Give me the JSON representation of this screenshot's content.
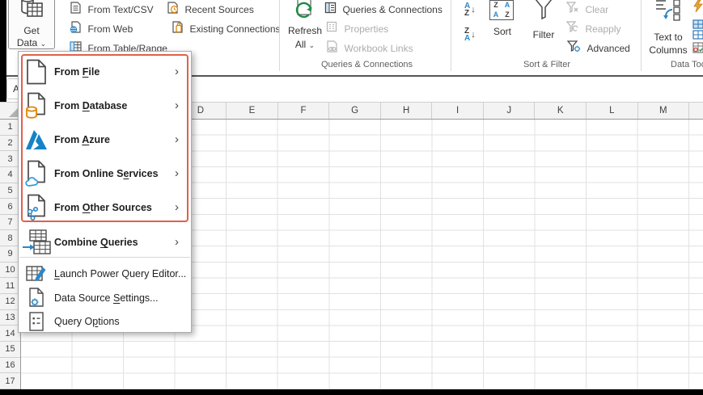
{
  "icons": {
    "submenu_chevron": "›",
    "dropdown_caret": "⌄",
    "sort_arrow": "↓",
    "letter_a": "A",
    "letter_z": "Z"
  },
  "colors": {
    "annotation_red": "#e1604b",
    "office_orange": "#de8500",
    "azure_blue": "#1583c7",
    "icon_blue": "#2e86c8",
    "refresh_green": "#1f8a44"
  },
  "ribbon": {
    "get_data": {
      "line1": "Get",
      "line2": "Data"
    },
    "get_transform_items": [
      {
        "label": "From Text/CSV"
      },
      {
        "label": "From Web"
      },
      {
        "label": "From Table/Range"
      },
      {
        "label": "Recent Sources"
      },
      {
        "label": "Existing Connections"
      }
    ],
    "refresh_all": {
      "line1": "Refresh",
      "line2": "All"
    },
    "queries_group": {
      "item1": "Queries & Connections",
      "item2": "Properties",
      "item3": "Workbook Links",
      "group_label": "Queries & Connections"
    },
    "sort_filter_group": {
      "sort_label": "Sort",
      "filter_label": "Filter",
      "clear_label": "Clear",
      "reapply_label": "Reapply",
      "advanced_label": "Advanced",
      "group_label": "Sort & Filter"
    },
    "data_tools_group": {
      "ttc_line1": "Text to",
      "ttc_line2": "Columns",
      "group_label": "Data Tools"
    }
  },
  "formula_bar": {
    "name_box_value": "A"
  },
  "menu": {
    "items": [
      {
        "pre": "From ",
        "accel": "F",
        "post": "ile"
      },
      {
        "pre": "From ",
        "accel": "D",
        "post": "atabase"
      },
      {
        "pre": "From ",
        "accel": "A",
        "post": "zure"
      },
      {
        "pre": "From Online S",
        "accel": "e",
        "post": "rvices"
      },
      {
        "pre": "From ",
        "accel": "O",
        "post": "ther Sources"
      },
      {
        "pre": "Combine ",
        "accel": "Q",
        "post": "ueries"
      },
      {
        "pre": "",
        "accel": "L",
        "post": "aunch Power Query Editor..."
      },
      {
        "pre": "Data Source ",
        "accel": "S",
        "post": "ettings..."
      },
      {
        "pre": "Query O",
        "accel": "p",
        "post": "tions"
      }
    ]
  },
  "grid": {
    "column_headers": [
      "",
      "",
      "",
      "D",
      "E",
      "F",
      "G",
      "H",
      "I",
      "J",
      "K",
      "L",
      "M",
      ""
    ],
    "row_headers": [
      "1",
      "2",
      "3",
      "4",
      "5",
      "6",
      "7",
      "8",
      "9",
      "10",
      "11",
      "12",
      "13",
      "14",
      "15",
      "16",
      "17"
    ]
  }
}
